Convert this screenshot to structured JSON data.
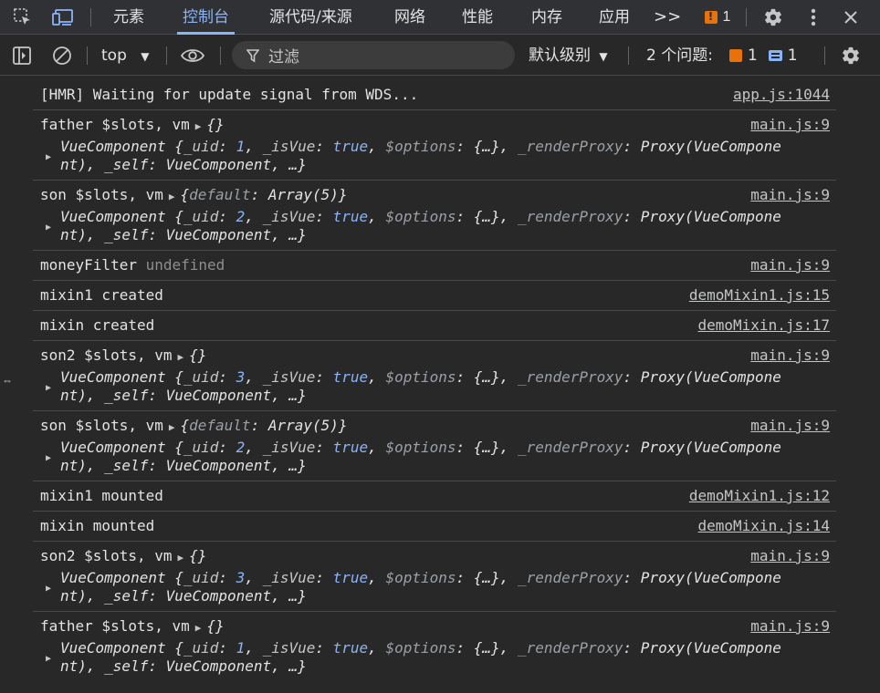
{
  "tabs": [
    "元素",
    "控制台",
    "源代码/来源",
    "网络",
    "性能",
    "内存",
    "应用"
  ],
  "active_tab": "控制台",
  "tabbar": {
    "more": ">>",
    "issue_count": "1"
  },
  "toolbar": {
    "context": "top",
    "filter_placeholder": "过滤",
    "level": "默认级别",
    "issues_label": "2 个问题:",
    "issue_warn_count": "1",
    "issue_info_count": "1"
  },
  "messages": [
    {
      "text": "[HMR] Waiting for update signal from WDS...",
      "source": "app.js:1044"
    },
    {
      "label": "father $slots, vm",
      "summary": "{}",
      "source": "main.js:9",
      "obj": {
        "uid": "1",
        "line2": "nt), _self: VueComponent, …}"
      }
    },
    {
      "label": "son $slots, vm",
      "summary_key": "default",
      "summary_val": "Array(5)",
      "source": "main.js:9",
      "obj": {
        "uid": "2",
        "line2": "nt), _self: VueComponent, …}"
      }
    },
    {
      "label": "moneyFilter",
      "value": "undefined",
      "source": "main.js:9"
    },
    {
      "text": "mixin1 created",
      "source": "demoMixin1.js:15"
    },
    {
      "text": "mixin created",
      "source": "demoMixin.js:17"
    },
    {
      "label": "son2 $slots, vm",
      "summary": "{}",
      "source": "main.js:9",
      "obj": {
        "uid": "3",
        "line2": "nt), _self: VueComponent, …}"
      }
    },
    {
      "label": "son $slots, vm",
      "summary_key": "default",
      "summary_val": "Array(5)",
      "source": "main.js:9",
      "obj": {
        "uid": "2",
        "line2": "nt), _self: VueComponent, …}"
      }
    },
    {
      "text": "mixin1 mounted",
      "source": "demoMixin1.js:12"
    },
    {
      "text": "mixin mounted",
      "source": "demoMixin.js:14"
    },
    {
      "label": "son2 $slots, vm",
      "summary": "{}",
      "source": "main.js:9",
      "obj": {
        "uid": "3",
        "line2": "nt), _self: VueComponent, …}"
      }
    },
    {
      "label": "father $slots, vm",
      "summary": "{}",
      "source": "main.js:9",
      "obj": {
        "uid": "1",
        "line2": "nt), _self: VueComponent, …}"
      }
    }
  ],
  "obj_common": {
    "class": "VueComponent",
    "open": "{",
    "uid_key": "_uid",
    "isVue_key": "_isVue",
    "isVue_val": "true",
    "options_key": "$options",
    "options_val": "{…}",
    "proxy_key": "_renderProxy",
    "proxy_val": "Proxy(VueCompone"
  },
  "colors": {
    "accent": "#8ab4f8",
    "warning": "#e8710a",
    "background": "#282828"
  }
}
